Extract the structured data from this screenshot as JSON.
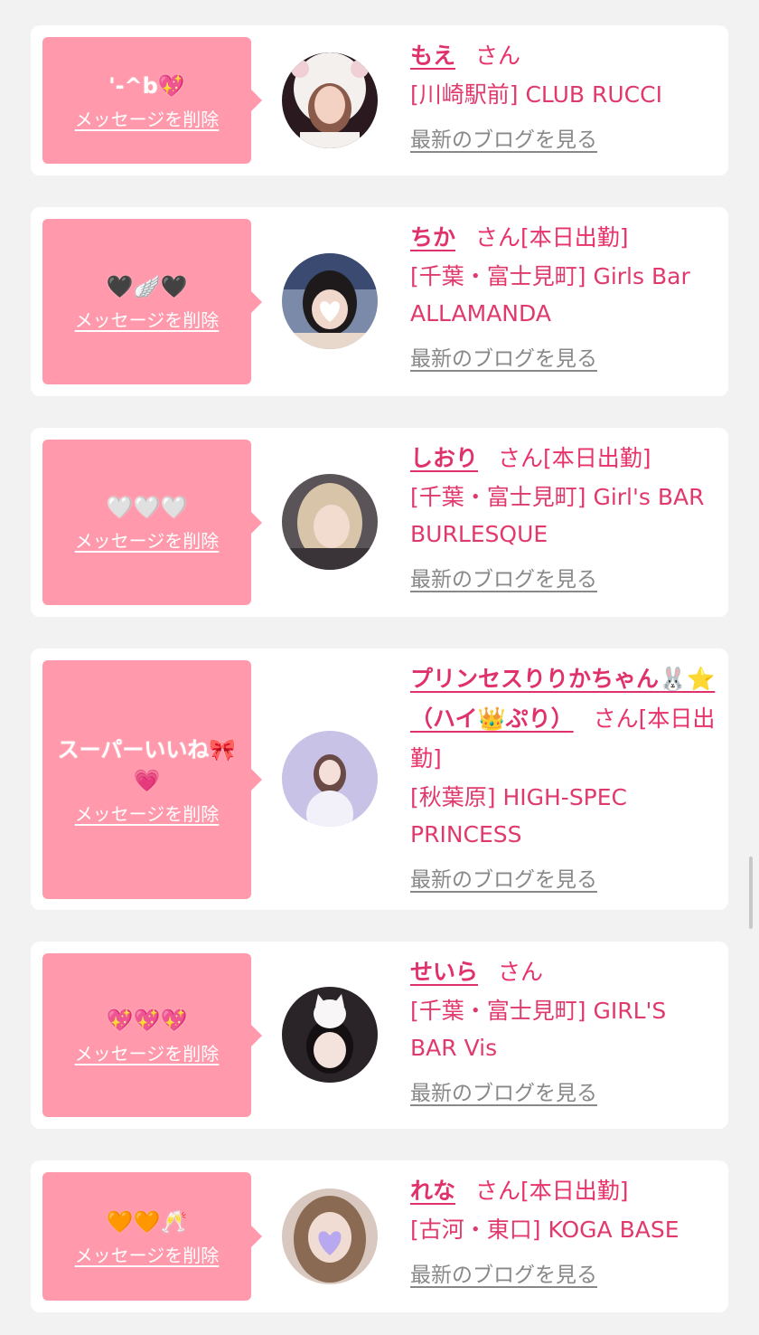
{
  "delete_label": "メッセージを削除",
  "san_suffix": "さん",
  "blog_label": "最新のブログを見る",
  "colors": {
    "accent": "#e0326a",
    "bubble": "#ff99ab",
    "background": "#f2f2f2"
  },
  "cards": [
    {
      "message": "'-^b💖",
      "name": "もえ",
      "status": "",
      "shop": "[川崎駅前] CLUB RUCCI"
    },
    {
      "message": "🖤🪽🖤",
      "name": "ちか",
      "status": "[本日出勤]",
      "shop": "[千葉・富士見町] Girls Bar ALLAMANDA"
    },
    {
      "message": "🤍🤍🤍",
      "name": "しおり",
      "status": "[本日出勤]",
      "shop": "[千葉・富士見町] Girl's BAR BURLESQUE"
    },
    {
      "message": "スーパーいいね🎀💗",
      "name": "プリンセスりりかちゃん🐰⭐️（ハイ👑ぷり）",
      "status": "[本日出勤]",
      "shop": "[秋葉原] HIGH-SPEC PRINCESS"
    },
    {
      "message": "💖💖💖",
      "name": "せいら",
      "status": "",
      "shop": "[千葉・富士見町] GIRL'S BAR Vis"
    },
    {
      "message": "🧡🧡🥂",
      "name": "れな",
      "status": "[本日出勤]",
      "shop": "[古河・東口] KOGA BASE"
    }
  ]
}
